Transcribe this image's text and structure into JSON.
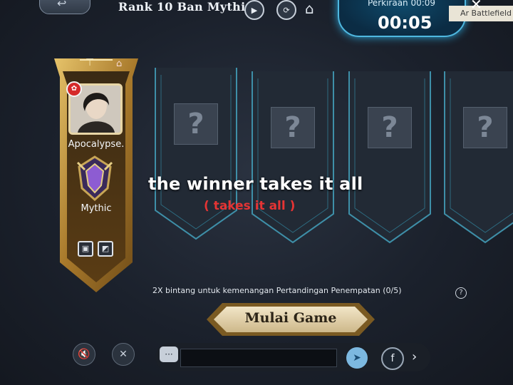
{
  "header": {
    "mode_title": "Rank 10 Ban Mythic",
    "timer_label": "Perkiraan 00:09",
    "timer_value": "00:05",
    "battlefield_tab": "Ar Battlefield"
  },
  "player": {
    "name": "Apocalypse.",
    "rank": "Mythic"
  },
  "slots": [
    {
      "label": "?"
    },
    {
      "label": "?"
    },
    {
      "label": "?"
    },
    {
      "label": "?"
    }
  ],
  "overlay": {
    "caption": "the winner takes it all",
    "caption_sub": "( takes it all )"
  },
  "hint": "2X bintang untuk kemenangan Pertandingan Penempatan (0/5)",
  "start_button": "Mulai Game",
  "colors": {
    "gold": "#c9a24a",
    "slot_outline": "#3e8fa8",
    "timer_glow": "#4fb8e0",
    "caption_red": "#e53434"
  },
  "icons": [
    "play-icon",
    "refresh-icon",
    "home-icon",
    "close-icon",
    "flag-icon",
    "mythic-emblem-icon",
    "bag-icon",
    "mic-mute-icon",
    "voice-mute-icon",
    "chat-icon",
    "telegram-icon",
    "facebook-icon",
    "chevron-right-icon"
  ]
}
